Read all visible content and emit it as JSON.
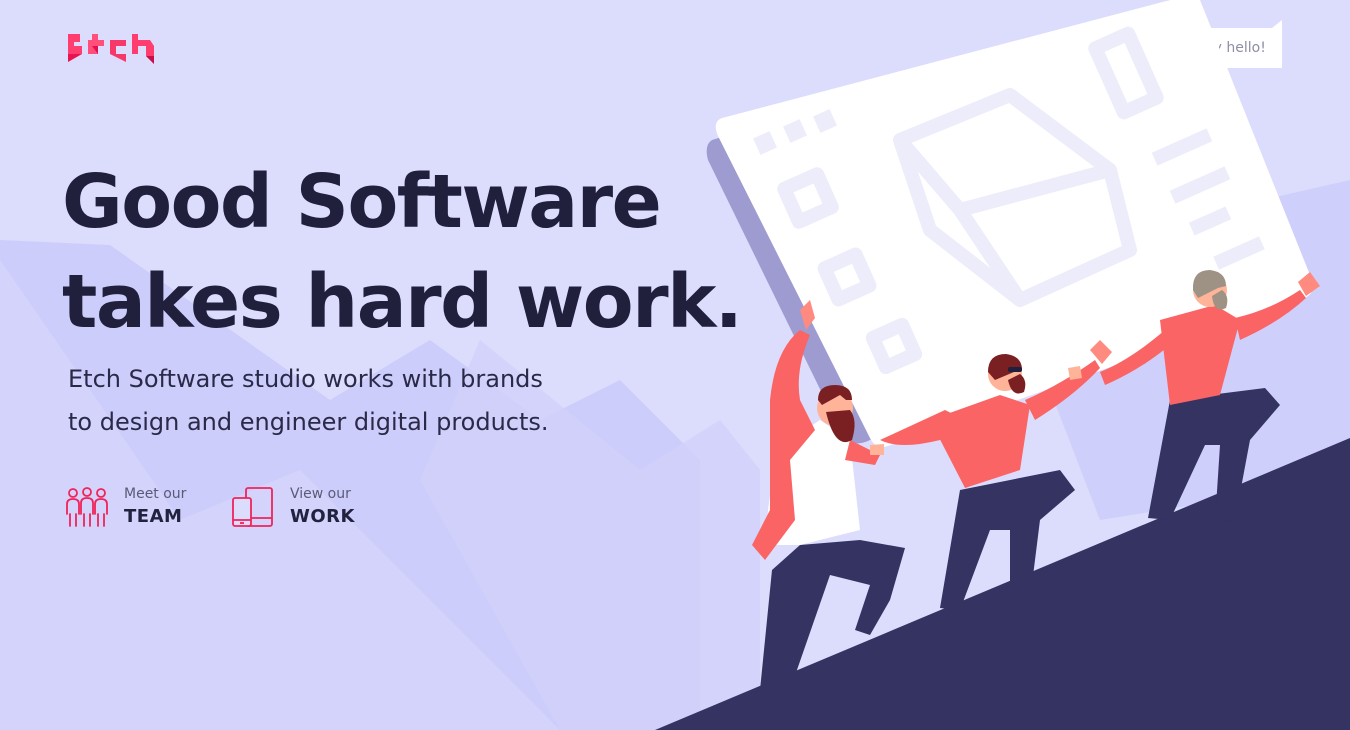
{
  "brand": {
    "logo_text": "Etch",
    "accent": "#f0245a",
    "text_dark": "#20203d",
    "background": "#dcdcfd",
    "slope": "#353362"
  },
  "header": {
    "say_hello_label": "Say hello!"
  },
  "hero": {
    "headline_line1": "Good Software",
    "headline_line2": "takes hard work.",
    "subtitle_line1": "Etch Software studio works with brands",
    "subtitle_line2": "to design and engineer digital products."
  },
  "ctas": {
    "team": {
      "small": "Meet our",
      "big": "TEAM",
      "icon": "team-icon"
    },
    "work": {
      "small": "View our",
      "big": "WORK",
      "icon": "devices-icon"
    }
  }
}
